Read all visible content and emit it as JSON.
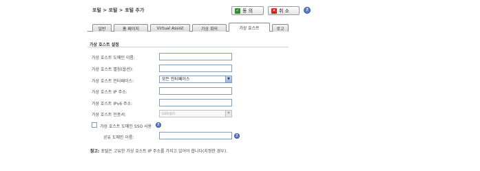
{
  "header": {
    "breadcrumb": "포털 > 포털 > 포털 추가",
    "ok_label": "동 의",
    "cancel_label": "취 소",
    "help": "?"
  },
  "tabs": [
    {
      "label": "일반"
    },
    {
      "label": "홈 페이지"
    },
    {
      "label": "Virtual Assist"
    },
    {
      "label": "가상 회의"
    },
    {
      "label": "가상 호스트"
    },
    {
      "label": "로고"
    }
  ],
  "section_title": "가상 호스트 설정",
  "form": {
    "domain_name_label": "가상 호스트 도메인 이름:",
    "alias_label": "가상 호스트 별칭(옵션):",
    "interface_label": "가상 호스트 인터페이스:",
    "interface_value": "모든 인터페이스",
    "ip_label": "가상 호스트 IP 주소:",
    "ipv6_label": "가상 호스트 IPv6 주소:",
    "cert_label": "가상 호스트 인증서:",
    "cert_value": "sslvpn",
    "sso_label": "가상 호스트 도메인 SSO 사용",
    "shared_domain_label": "공유 도메인 이름:"
  },
  "note": {
    "prefix": "참고:",
    "text": " 포털은 고유한 가상 호스트 IP 주소를 가지고 있어야 합니다(지정한 경우)."
  }
}
